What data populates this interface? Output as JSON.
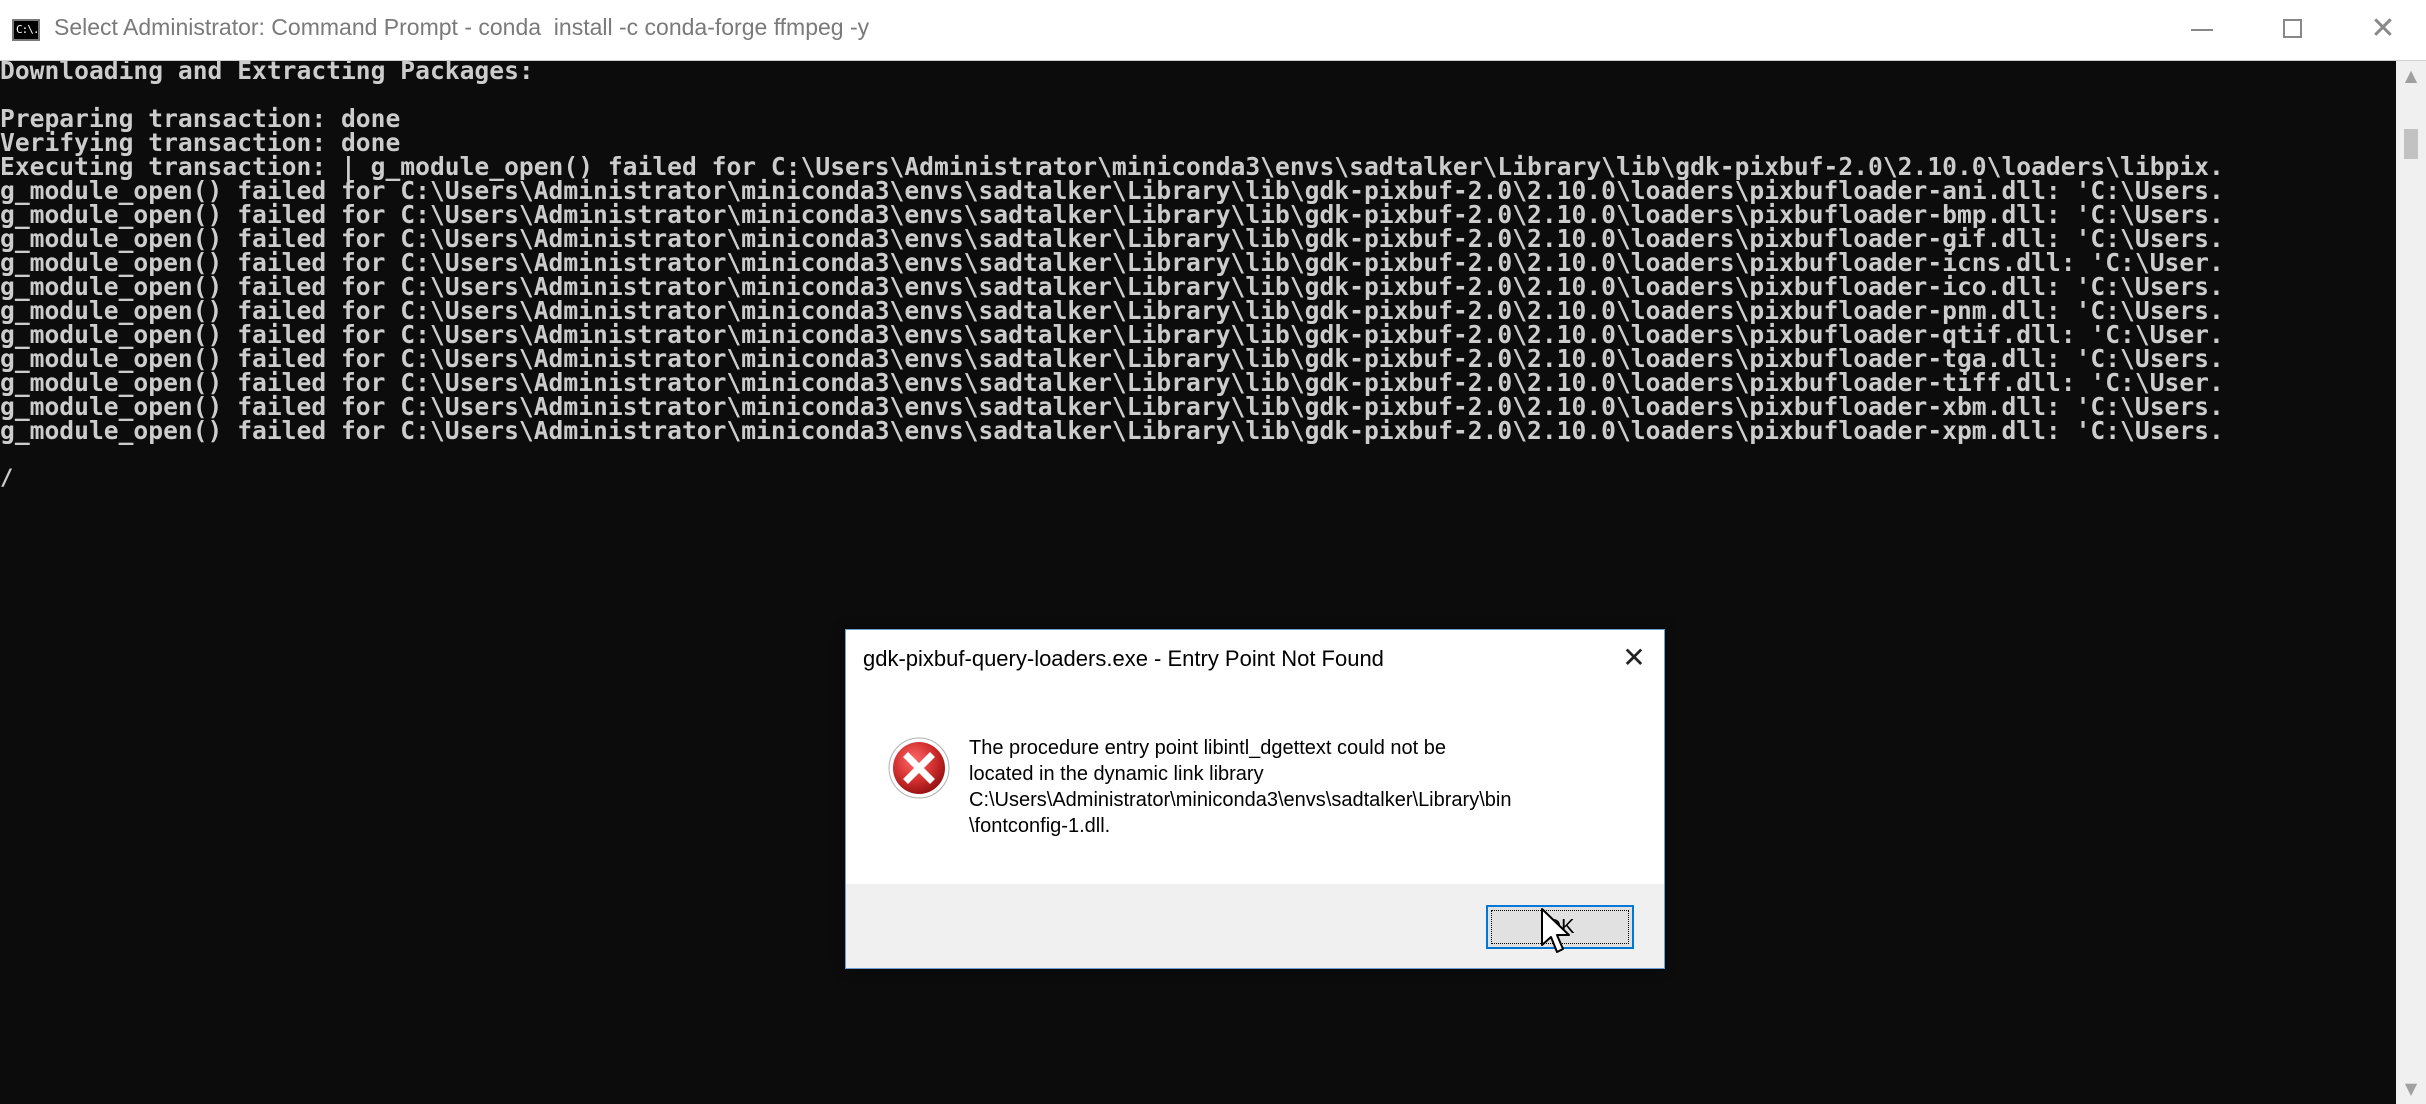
{
  "window": {
    "title": "Select Administrator: Command Prompt - conda  install -c conda-forge ffmpeg -y",
    "icon_label": "C:\\.",
    "minimize_icon": "minimize-icon",
    "maximize_icon": "maximize-icon",
    "close_glyph": "✕"
  },
  "console": {
    "lines": [
      "Downloading and Extracting Packages:",
      "",
      "Preparing transaction: done",
      "Verifying transaction: done",
      "Executing transaction: | g_module_open() failed for C:\\Users\\Administrator\\miniconda3\\envs\\sadtalker\\Library\\lib\\gdk-pixbuf-2.0\\2.10.0\\loaders\\libpix.",
      "g_module_open() failed for C:\\Users\\Administrator\\miniconda3\\envs\\sadtalker\\Library\\lib\\gdk-pixbuf-2.0\\2.10.0\\loaders\\pixbufloader-ani.dll: 'C:\\Users.",
      "g_module_open() failed for C:\\Users\\Administrator\\miniconda3\\envs\\sadtalker\\Library\\lib\\gdk-pixbuf-2.0\\2.10.0\\loaders\\pixbufloader-bmp.dll: 'C:\\Users.",
      "g_module_open() failed for C:\\Users\\Administrator\\miniconda3\\envs\\sadtalker\\Library\\lib\\gdk-pixbuf-2.0\\2.10.0\\loaders\\pixbufloader-gif.dll: 'C:\\Users.",
      "g_module_open() failed for C:\\Users\\Administrator\\miniconda3\\envs\\sadtalker\\Library\\lib\\gdk-pixbuf-2.0\\2.10.0\\loaders\\pixbufloader-icns.dll: 'C:\\User.",
      "g_module_open() failed for C:\\Users\\Administrator\\miniconda3\\envs\\sadtalker\\Library\\lib\\gdk-pixbuf-2.0\\2.10.0\\loaders\\pixbufloader-ico.dll: 'C:\\Users.",
      "g_module_open() failed for C:\\Users\\Administrator\\miniconda3\\envs\\sadtalker\\Library\\lib\\gdk-pixbuf-2.0\\2.10.0\\loaders\\pixbufloader-pnm.dll: 'C:\\Users.",
      "g_module_open() failed for C:\\Users\\Administrator\\miniconda3\\envs\\sadtalker\\Library\\lib\\gdk-pixbuf-2.0\\2.10.0\\loaders\\pixbufloader-qtif.dll: 'C:\\User.",
      "g_module_open() failed for C:\\Users\\Administrator\\miniconda3\\envs\\sadtalker\\Library\\lib\\gdk-pixbuf-2.0\\2.10.0\\loaders\\pixbufloader-tga.dll: 'C:\\Users.",
      "g_module_open() failed for C:\\Users\\Administrator\\miniconda3\\envs\\sadtalker\\Library\\lib\\gdk-pixbuf-2.0\\2.10.0\\loaders\\pixbufloader-tiff.dll: 'C:\\User.",
      "g_module_open() failed for C:\\Users\\Administrator\\miniconda3\\envs\\sadtalker\\Library\\lib\\gdk-pixbuf-2.0\\2.10.0\\loaders\\pixbufloader-xbm.dll: 'C:\\Users.",
      "g_module_open() failed for C:\\Users\\Administrator\\miniconda3\\envs\\sadtalker\\Library\\lib\\gdk-pixbuf-2.0\\2.10.0\\loaders\\pixbufloader-xpm.dll: 'C:\\Users."
    ],
    "spinner": "/"
  },
  "scrollbar": {
    "up_glyph": "▲",
    "down_glyph": "▼"
  },
  "dialog": {
    "title": "gdk-pixbuf-query-loaders.exe - Entry Point Not Found",
    "close_glyph": "✕",
    "icon": "error-icon",
    "message_lines": [
      "The procedure entry point libintl_dgettext could not be",
      "located in the dynamic link library",
      "C:\\Users\\Administrator\\miniconda3\\envs\\sadtalker\\Library\\bin",
      "\\fontconfig-1.dll."
    ],
    "ok_label": "OK"
  },
  "colors": {
    "console_bg": "#0c0c0c",
    "console_text": "#cccccc",
    "dialog_border": "#6c9fd0",
    "focus_blue": "#0078d7",
    "error_red": "#d32f2f"
  }
}
